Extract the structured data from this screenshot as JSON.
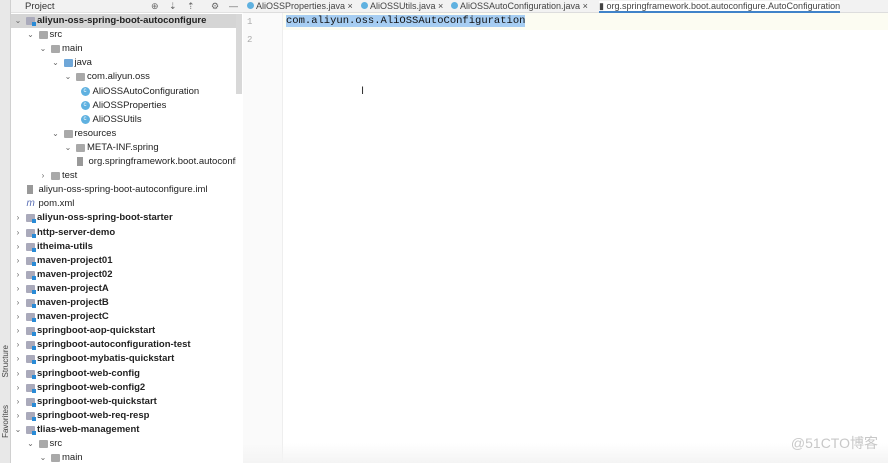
{
  "side_stripe": {
    "labels": [
      "Structure",
      "Favorites"
    ]
  },
  "project_panel": {
    "title": "Project"
  },
  "tabs": [
    {
      "label": "AliOSSProperties.java",
      "active": false
    },
    {
      "label": "AliOSSUtils.java",
      "active": false
    },
    {
      "label": "AliOSSAutoConfiguration.java",
      "active": false
    },
    {
      "label": "org.springframework.boot.autoconfigure.AutoConfiguration",
      "active": true
    }
  ],
  "tree": [
    {
      "label": "aliyun-oss-spring-boot-autoconfigure",
      "depth": 0,
      "type": "module",
      "state": "open",
      "bold": true,
      "selected": true
    },
    {
      "label": "src",
      "depth": 1,
      "type": "folder",
      "state": "open"
    },
    {
      "label": "main",
      "depth": 2,
      "type": "folder",
      "state": "open"
    },
    {
      "label": "java",
      "depth": 3,
      "type": "src",
      "state": "open"
    },
    {
      "label": "com.aliyun.oss",
      "depth": 4,
      "type": "folder",
      "state": "open"
    },
    {
      "label": "AliOSSAutoConfiguration",
      "depth": 5,
      "type": "class",
      "state": "leaf"
    },
    {
      "label": "AliOSSProperties",
      "depth": 5,
      "type": "class",
      "state": "leaf"
    },
    {
      "label": "AliOSSUtils",
      "depth": 5,
      "type": "class",
      "state": "leaf"
    },
    {
      "label": "resources",
      "depth": 3,
      "type": "folder",
      "state": "open"
    },
    {
      "label": "META-INF.spring",
      "depth": 4,
      "type": "folder",
      "state": "open"
    },
    {
      "label": "org.springframework.boot.autoconfigure.AutoConfiguration.imports",
      "depth": 5,
      "type": "file",
      "state": "leaf"
    },
    {
      "label": "test",
      "depth": 2,
      "type": "folder",
      "state": "closed"
    },
    {
      "label": "aliyun-oss-spring-boot-autoconfigure.iml",
      "depth": 1,
      "type": "file",
      "state": "leaf"
    },
    {
      "label": "pom.xml",
      "depth": 1,
      "type": "maven",
      "state": "leaf"
    },
    {
      "label": "aliyun-oss-spring-boot-starter",
      "depth": 0,
      "type": "module",
      "state": "closed",
      "bold": true
    },
    {
      "label": "http-server-demo",
      "depth": 0,
      "type": "module",
      "state": "closed",
      "bold": true
    },
    {
      "label": "itheima-utils",
      "depth": 0,
      "type": "module",
      "state": "closed",
      "bold": true
    },
    {
      "label": "maven-project01",
      "depth": 0,
      "type": "module",
      "state": "closed",
      "bold": true
    },
    {
      "label": "maven-project02",
      "depth": 0,
      "type": "module",
      "state": "closed",
      "bold": true
    },
    {
      "label": "maven-projectA",
      "depth": 0,
      "type": "module",
      "state": "closed",
      "bold": true
    },
    {
      "label": "maven-projectB",
      "depth": 0,
      "type": "module",
      "state": "closed",
      "bold": true
    },
    {
      "label": "maven-projectC",
      "depth": 0,
      "type": "module",
      "state": "closed",
      "bold": true
    },
    {
      "label": "springboot-aop-quickstart",
      "depth": 0,
      "type": "module",
      "state": "closed",
      "bold": true
    },
    {
      "label": "springboot-autoconfiguration-test",
      "depth": 0,
      "type": "module",
      "state": "closed",
      "bold": true
    },
    {
      "label": "springboot-mybatis-quickstart",
      "depth": 0,
      "type": "module",
      "state": "closed",
      "bold": true
    },
    {
      "label": "springboot-web-config",
      "depth": 0,
      "type": "module",
      "state": "closed",
      "bold": true
    },
    {
      "label": "springboot-web-config2",
      "depth": 0,
      "type": "module",
      "state": "closed",
      "bold": true
    },
    {
      "label": "springboot-web-quickstart",
      "depth": 0,
      "type": "module",
      "state": "closed",
      "bold": true
    },
    {
      "label": "springboot-web-req-resp",
      "depth": 0,
      "type": "module",
      "state": "closed",
      "bold": true
    },
    {
      "label": "tlias-web-management",
      "depth": 0,
      "type": "module",
      "state": "open",
      "bold": true
    },
    {
      "label": "src",
      "depth": 1,
      "type": "folder",
      "state": "open"
    },
    {
      "label": "main",
      "depth": 2,
      "type": "folder",
      "state": "open"
    }
  ],
  "editor": {
    "line_numbers": [
      "1",
      "2"
    ],
    "lines": [
      "com.aliyun.oss.AliOSSAutoConfiguration",
      ""
    ]
  },
  "watermark": "@51CTO博客"
}
